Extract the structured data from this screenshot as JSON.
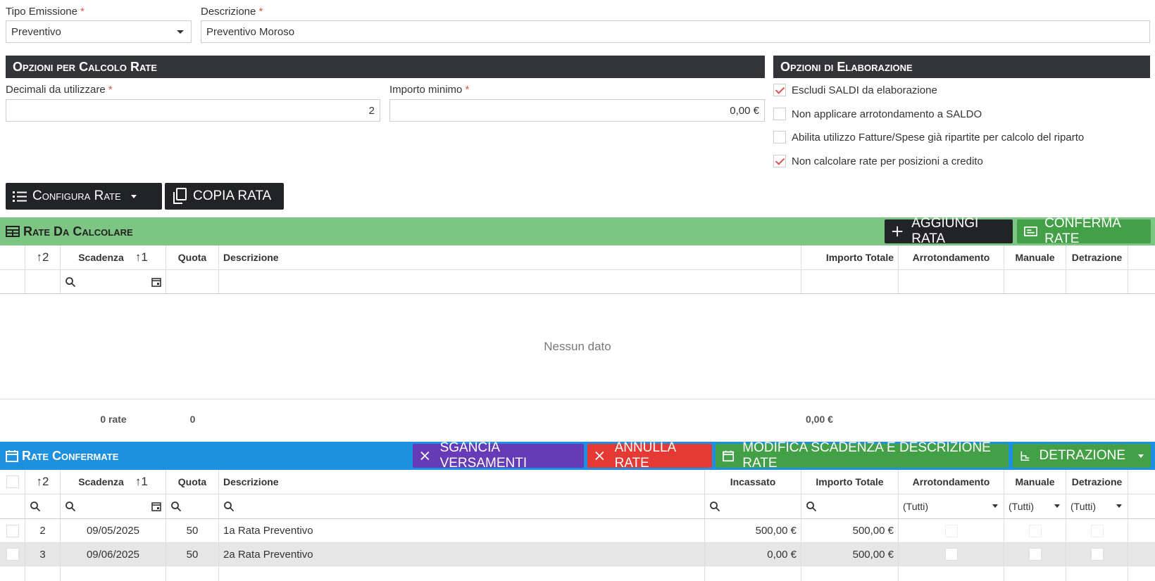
{
  "form": {
    "tipo_label": "Tipo Emissione",
    "tipo_value": "Preventivo",
    "desc_label": "Descrizione",
    "desc_value": "Preventivo Moroso",
    "required_mark": "*"
  },
  "calc_options": {
    "title": "Opzioni per Calcolo Rate",
    "decimali_label": "Decimali da utilizzare",
    "decimali_value": "2",
    "importo_label": "Importo minimo",
    "importo_value": "0,00 €"
  },
  "elab_options": {
    "title": "Opzioni di Elaborazione",
    "items": [
      {
        "label": "Escludi SALDI da elaborazione",
        "checked": true
      },
      {
        "label": "Non applicare arrotondamento a SALDO",
        "checked": false
      },
      {
        "label": "Abilita utilizzo Fatture/Spese già ripartite per calcolo del riparto",
        "checked": false
      },
      {
        "label": "Non calcolare rate per posizioni a credito",
        "checked": true
      }
    ]
  },
  "toolbar": {
    "configura_label": "Configura Rate",
    "copia_label": "COPIA RATA"
  },
  "rate_da_calcolare": {
    "title": "Rate Da Calcolare",
    "aggiungi_label": "AGGIUNGI RATA",
    "conferma_label": "CONFERMA RATE",
    "sort1": "2",
    "sort2": "1",
    "headers": {
      "scadenza": "Scadenza",
      "quota": "Quota",
      "descrizione": "Descrizione",
      "importo": "Importo Totale",
      "arrot": "Arrotondamento",
      "manuale": "Manuale",
      "detrazione": "Detrazione"
    },
    "empty_text": "Nessun dato",
    "footer": {
      "count": "0 rate",
      "quota": "0",
      "importo": "0,00 €"
    }
  },
  "rate_confermate": {
    "title": "Rate Confermate",
    "sgancia_label": "SGANCIA VERSAMENTI",
    "annulla_label": "ANNULLA RATE",
    "modifica_label": "MODIFICA SCADENZA E DESCRIZIONE RATE",
    "detrazione_label": "DETRAZIONE",
    "sort1": "2",
    "sort2": "1",
    "headers": {
      "scadenza": "Scadenza",
      "quota": "Quota",
      "descrizione": "Descrizione",
      "incassato": "Incassato",
      "importo": "Importo Totale",
      "arrot": "Arrotondamento",
      "manuale": "Manuale",
      "detrazione": "Detrazione"
    },
    "filter_all": "(Tutti)",
    "rows": [
      {
        "num": "2",
        "scadenza": "09/05/2025",
        "quota": "50",
        "descrizione": "1a Rata Preventivo",
        "incassato": "500,00 €",
        "importo": "500,00 €"
      },
      {
        "num": "3",
        "scadenza": "09/06/2025",
        "quota": "50",
        "descrizione": "2a Rata Preventivo",
        "incassato": "0,00 €",
        "importo": "500,00 €"
      }
    ]
  },
  "colors": {
    "dark": "#333437",
    "green_bar": "#7dc583",
    "blue_bar": "#1e90e0",
    "purple": "#673ab7",
    "red": "#e53935",
    "green_btn": "#43a047",
    "required": "#d9534f"
  }
}
